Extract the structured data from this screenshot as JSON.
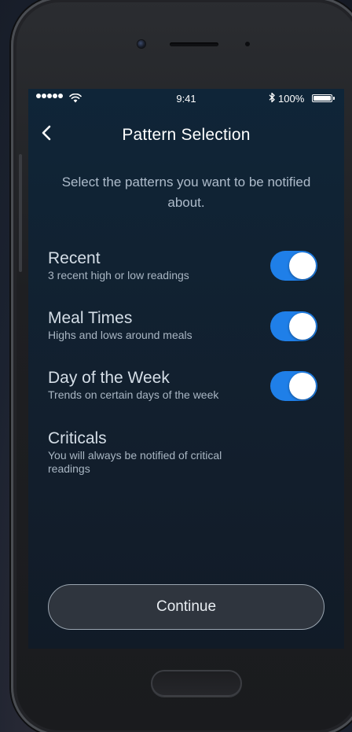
{
  "status_bar": {
    "time": "9:41",
    "battery_percent": "100%",
    "battery_level": 1.0,
    "signal_dots": 5,
    "icons": [
      "signal-dots-icon",
      "wifi-icon",
      "bluetooth-icon",
      "battery-icon"
    ]
  },
  "nav": {
    "title": "Pattern Selection",
    "back_icon": "chevron-left-icon"
  },
  "intro": "Select the patterns you want to be notified about.",
  "patterns": [
    {
      "title": "Recent",
      "subtitle": "3 recent high or low readings",
      "enabled": true
    },
    {
      "title": "Meal Times",
      "subtitle": "Highs and lows around meals",
      "enabled": true
    },
    {
      "title": "Day of the Week",
      "subtitle": "Trends on certain days of the week",
      "enabled": true
    },
    {
      "title": "Criticals",
      "subtitle": "You will always be notified of critical readings"
    }
  ],
  "continue_label": "Continue",
  "colors": {
    "toggle_on": "#1f7fe8",
    "screen_background": "#112232",
    "button_background": "#2f353e"
  }
}
